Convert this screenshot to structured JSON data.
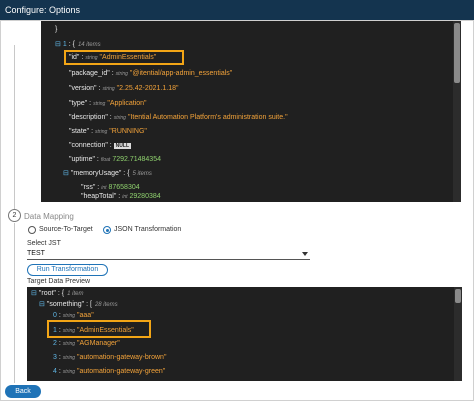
{
  "window": {
    "title": "Configure: Options"
  },
  "top_json": {
    "lines": [
      {
        "text": "}",
        "kind": "brace"
      },
      {
        "index": "1",
        "items": "14 items",
        "kind": "array-head"
      },
      {
        "key": "\"id\"",
        "type": "string",
        "value": "\"AdminEssentials\"",
        "kind": "str"
      },
      {
        "key": "\"package_id\"",
        "type": "string",
        "value": "\"@itential/app-admin_essentials\"",
        "kind": "str"
      },
      {
        "key": "\"version\"",
        "type": "string",
        "value": "\"2.25.42-2021.1.18\"",
        "kind": "str"
      },
      {
        "key": "\"type\"",
        "type": "string",
        "value": "\"Application\"",
        "kind": "str"
      },
      {
        "key": "\"description\"",
        "type": "string",
        "value": "\"Itential Automation Platform's administration suite.\"",
        "kind": "str"
      },
      {
        "key": "\"state\"",
        "type": "string",
        "value": "\"RUNNING\"",
        "kind": "str"
      },
      {
        "key": "\"connection\"",
        "type": "",
        "value": "NULL",
        "kind": "null"
      },
      {
        "key": "\"uptime\"",
        "type": "float",
        "value": "7292.71484354",
        "kind": "num"
      },
      {
        "key": "\"memoryUsage\"",
        "items": "5 items",
        "kind": "obj-head"
      },
      {
        "key": "\"rss\"",
        "type": "int",
        "value": "87658304",
        "kind": "num"
      },
      {
        "key": "\"heapTotal\"",
        "type": "int",
        "value": "29280384",
        "kind": "num"
      }
    ]
  },
  "data_mapping": {
    "step_number": "2",
    "title": "Data Mapping",
    "option_source": "Source-To-Target",
    "option_json": "JSON Transformation",
    "select_label": "Select JST",
    "select_value": "TEST",
    "run_button": "Run Transformation",
    "preview_label": "Target Data Preview"
  },
  "preview_json": {
    "root_key": "\"root\"",
    "root_items": "1 item",
    "something_key": "\"something\"",
    "something_items": "28 items",
    "entries": [
      {
        "index": "0",
        "type": "string",
        "value": "\"aaa\""
      },
      {
        "index": "1",
        "type": "string",
        "value": "\"AdminEssentials\""
      },
      {
        "index": "2",
        "type": "string",
        "value": "\"AGManager\""
      },
      {
        "index": "3",
        "type": "string",
        "value": "\"automation-gateway-brown\""
      },
      {
        "index": "4",
        "type": "string",
        "value": "\"automation-gateway-green\""
      }
    ]
  },
  "footer": {
    "back_button": "Back"
  }
}
